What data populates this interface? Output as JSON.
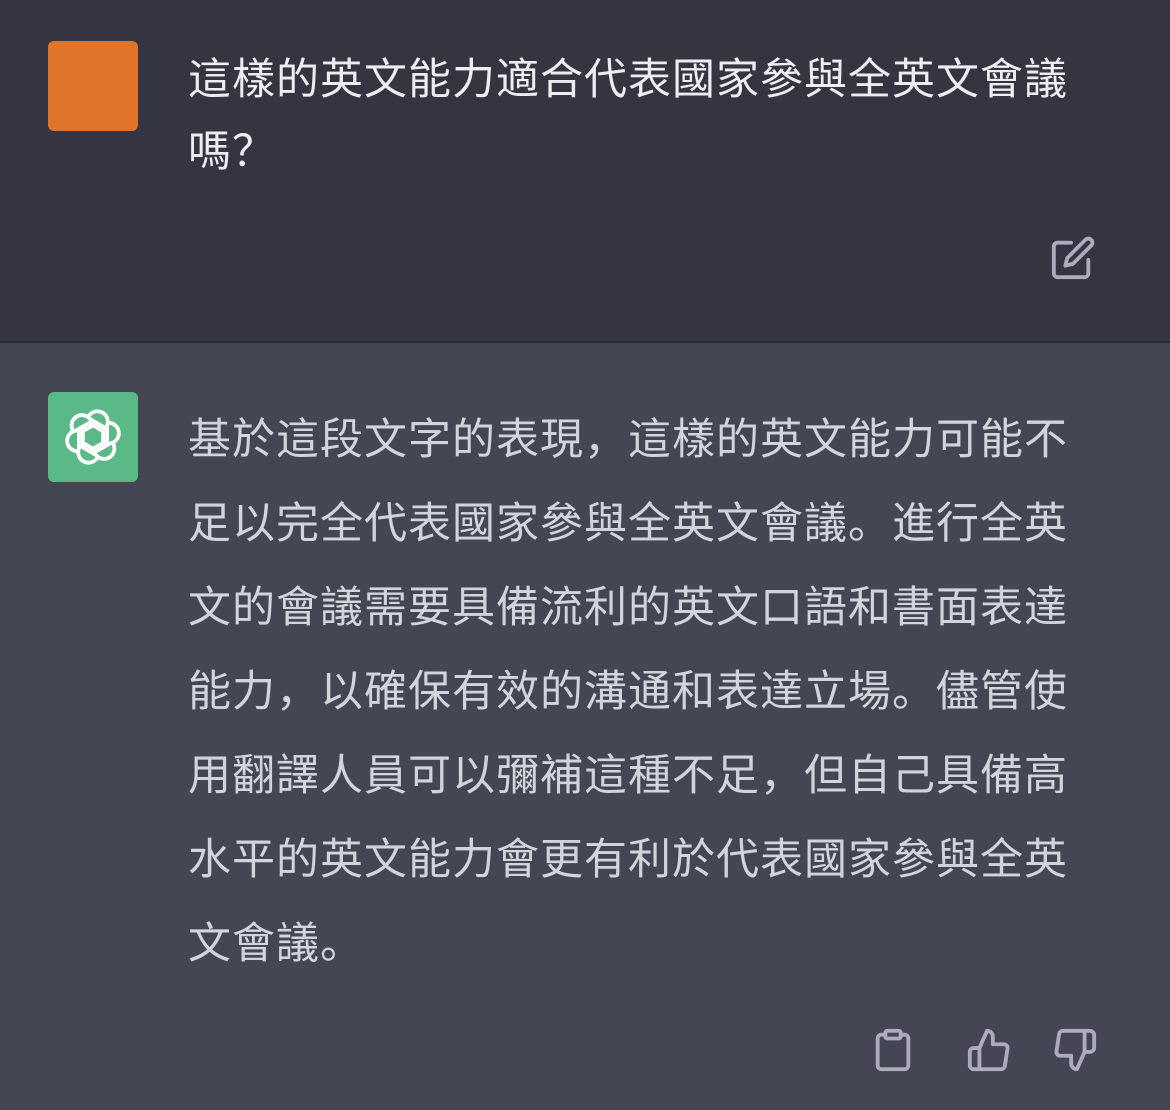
{
  "user_message": {
    "text": "這樣的英文能力適合代表國家參與全英文會議嗎？",
    "avatar_color": "#e0742b",
    "edit_icon": "edit-icon"
  },
  "assistant_message": {
    "text": "基於這段文字的表現，這樣的英文能力可能不足以完全代表國家參與全英文會議。進行全英文的會議需要具備流利的英文口語和書面表達能力，以確保有效的溝通和表達立場。儘管使用翻譯人員可以彌補這種不足，但自己具備高水平的英文能力會更有利於代表國家參與全英文會議。",
    "avatar_color": "#5bb987",
    "avatar_icon": "openai-logo-icon",
    "actions": [
      "copy-icon",
      "thumbs-up-icon",
      "thumbs-down-icon"
    ]
  },
  "colors": {
    "user_bg": "#343541",
    "assistant_bg": "#444654",
    "text": "#ececf1",
    "icon": "#acacbe"
  }
}
